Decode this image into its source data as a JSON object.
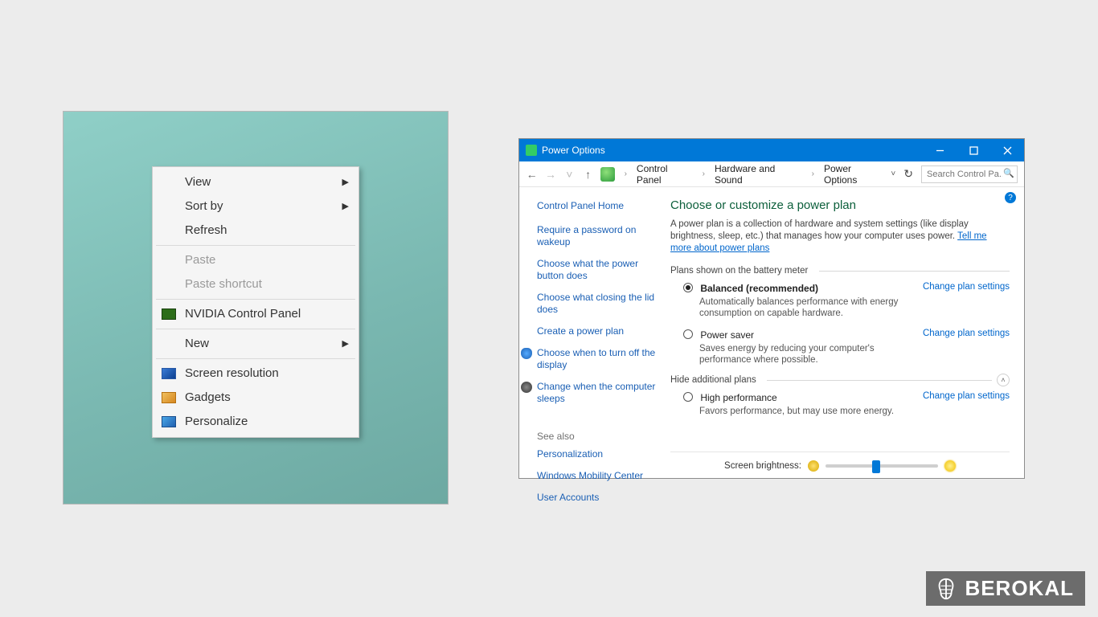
{
  "context_menu": {
    "view": "View",
    "sortby": "Sort by",
    "refresh": "Refresh",
    "paste": "Paste",
    "paste_shortcut": "Paste shortcut",
    "nvidia": "NVIDIA Control Panel",
    "new": "New",
    "screen_res": "Screen resolution",
    "gadgets": "Gadgets",
    "personalize": "Personalize"
  },
  "window": {
    "title": "Power Options",
    "breadcrumb": {
      "cp": "Control Panel",
      "hw": "Hardware and Sound",
      "po": "Power Options"
    },
    "search_placeholder": "Search Control Pa..."
  },
  "sidebar": {
    "home": "Control Panel Home",
    "links": {
      "require_password": "Require a password on wakeup",
      "power_button": "Choose what the power button does",
      "closing_lid": "Choose what closing the lid does",
      "create_plan": "Create a power plan",
      "turn_off_display": "Choose when to turn off the display",
      "computer_sleeps": "Change when the computer sleeps"
    },
    "see_also": "See also",
    "see_also_links": {
      "personalization": "Personalization",
      "mobility": "Windows Mobility Center",
      "user_accounts": "User Accounts"
    }
  },
  "main": {
    "heading": "Choose or customize a power plan",
    "desc1": "A power plan is a collection of hardware and system settings (like display brightness, sleep, etc.) that manages how your computer uses power. ",
    "desc_link": "Tell me more about power plans",
    "plans_label": "Plans shown on the battery meter",
    "hide_label": "Hide additional plans",
    "change": "Change plan settings",
    "balanced": {
      "name": "Balanced (recommended)",
      "sub": "Automatically balances performance with energy consumption on capable hardware."
    },
    "powersaver": {
      "name": "Power saver",
      "sub": "Saves energy by reducing your computer's performance where possible."
    },
    "highperf": {
      "name": "High performance",
      "sub": "Favors performance, but may use more energy."
    },
    "brightness_label": "Screen brightness:"
  },
  "watermark": "BEROKAL"
}
